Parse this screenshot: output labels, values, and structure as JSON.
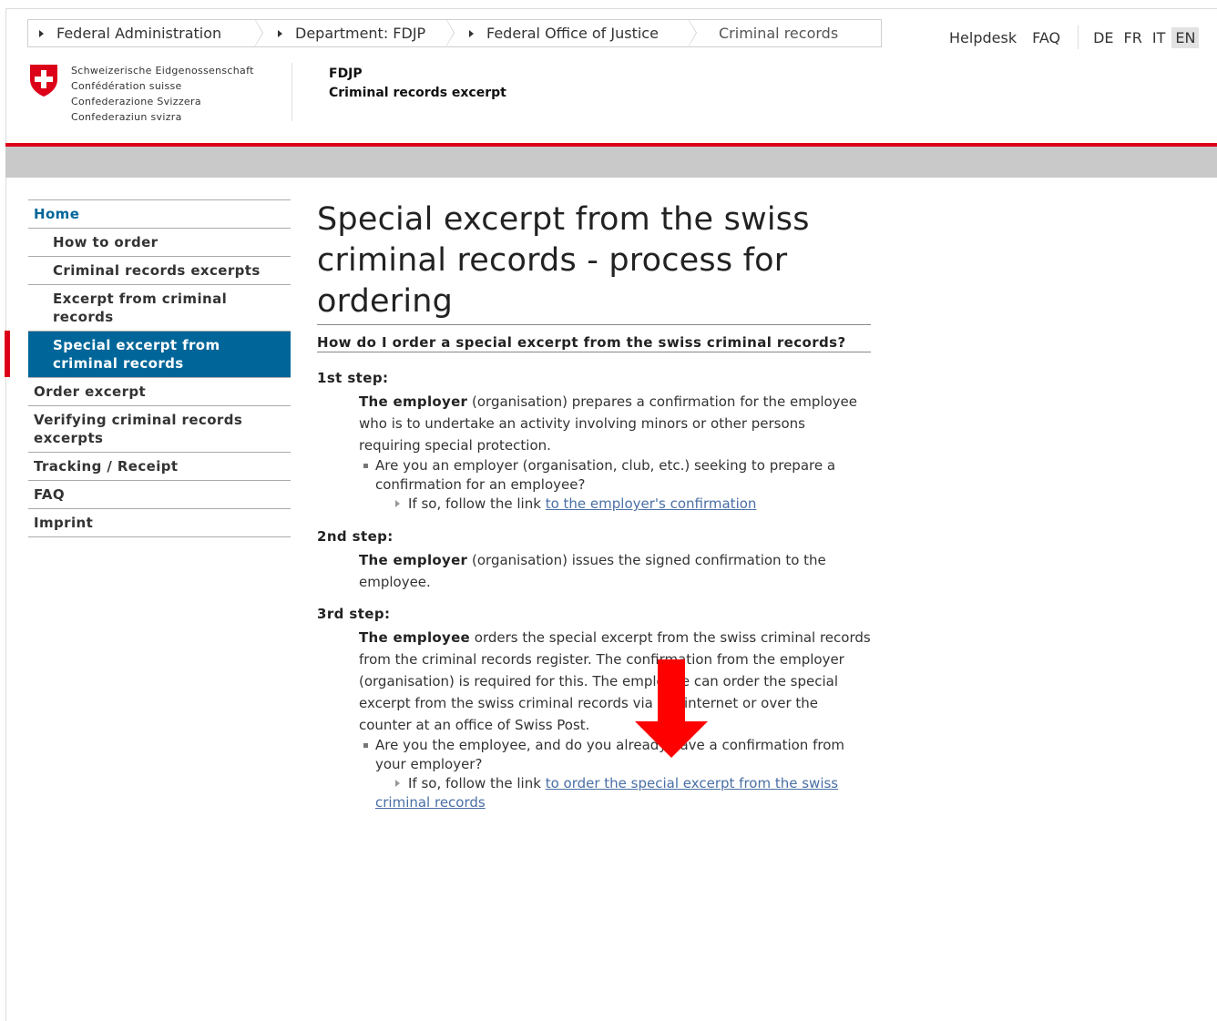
{
  "breadcrumb": [
    "Federal Administration",
    "Department: FDJP",
    "Federal Office of Justice",
    "Criminal records"
  ],
  "topnav": {
    "helpdesk": "Helpdesk",
    "faq": "FAQ",
    "languages": [
      "DE",
      "FR",
      "IT",
      "EN"
    ],
    "active_language": "EN"
  },
  "logo": {
    "lines": [
      "Schweizerische Eidgenossenschaft",
      "Confédération suisse",
      "Confederazione Svizzera",
      "Confederaziun svizra"
    ]
  },
  "dept": {
    "short": "FDJP",
    "title": "Criminal records excerpt"
  },
  "sidebar": {
    "items": [
      {
        "label": "Home"
      },
      {
        "label": "How to order"
      },
      {
        "label": "Criminal records excerpts"
      },
      {
        "label": "Excerpt from criminal records"
      },
      {
        "label": "Special excerpt from criminal records"
      },
      {
        "label": "Order excerpt"
      },
      {
        "label": "Verifying criminal records excerpts"
      },
      {
        "label": "Tracking / Receipt"
      },
      {
        "label": "FAQ"
      },
      {
        "label": "Imprint"
      }
    ]
  },
  "main": {
    "title": "Special excerpt from the swiss criminal records - process for ordering",
    "subhead": "How do I order a special excerpt from the swiss criminal records?",
    "step1": {
      "label": "1st step:",
      "lead": "The employer",
      "text": " (organisation) prepares a confirmation for the employee who is to undertake an activity involving minors or other persons requiring special protection.",
      "bullet": "Are you an employer (organisation, club, etc.) seeking to prepare a confirmation for an employee?",
      "follow": "If so, follow the link ",
      "link": "to the employer's confirmation"
    },
    "step2": {
      "label": "2nd step:",
      "lead": "The employer",
      "text": " (organisation) issues the signed confirmation to the employee."
    },
    "step3": {
      "label": "3rd step:",
      "lead": "The employee",
      "text": " orders the special excerpt from the swiss criminal records from the criminal records register. The confirmation from the employer (organisation) is required for this. The employee can order the special excerpt from the swiss criminal records via the internet or over the counter at an office of Swiss Post.",
      "bullet": "Are you the employee, and do you already have a confirmation from your employer?",
      "follow": "If so, follow the link ",
      "link": "to order the special excerpt from the swiss criminal records"
    }
  },
  "colors": {
    "accent": "#006699",
    "swiss_red": "#dc0018",
    "arrow": "#ff0000"
  }
}
